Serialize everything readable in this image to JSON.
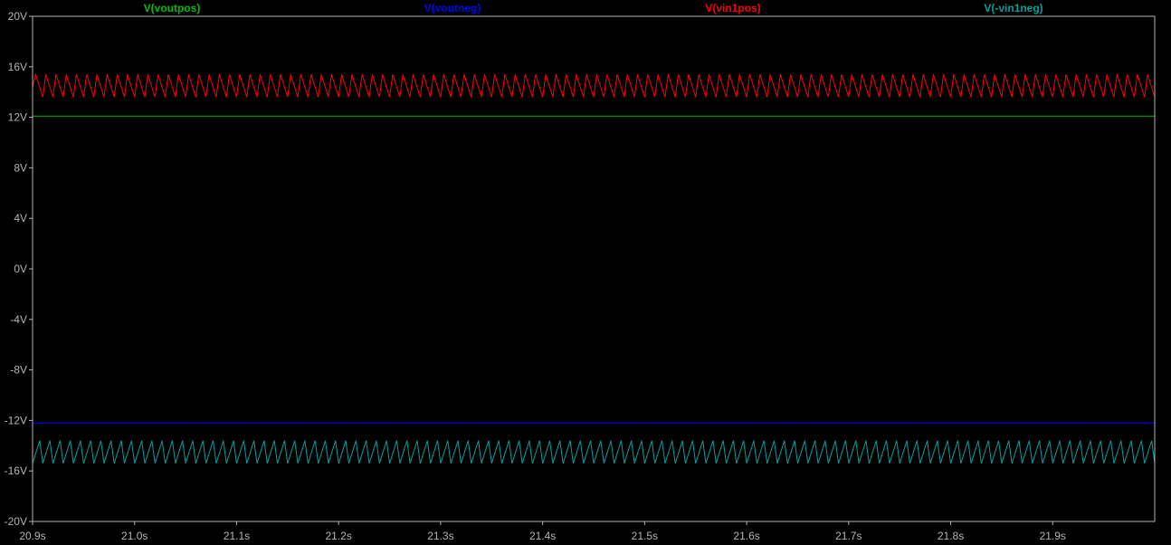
{
  "chart_data": {
    "type": "line",
    "title": "",
    "xlabel": "",
    "ylabel": "",
    "xlim": [
      20.9,
      22.0
    ],
    "ylim": [
      -20,
      20
    ],
    "grid": false,
    "legend_placement": "top",
    "x_ticks": [
      {
        "value": 20.9,
        "label": "20.9s"
      },
      {
        "value": 21.0,
        "label": "21.0s"
      },
      {
        "value": 21.1,
        "label": "21.1s"
      },
      {
        "value": 21.2,
        "label": "21.2s"
      },
      {
        "value": 21.3,
        "label": "21.3s"
      },
      {
        "value": 21.4,
        "label": "21.4s"
      },
      {
        "value": 21.5,
        "label": "21.5s"
      },
      {
        "value": 21.6,
        "label": "21.6s"
      },
      {
        "value": 21.7,
        "label": "21.7s"
      },
      {
        "value": 21.8,
        "label": "21.8s"
      },
      {
        "value": 21.9,
        "label": "21.9s"
      }
    ],
    "y_ticks": [
      {
        "value": 20,
        "label": "20V"
      },
      {
        "value": 16,
        "label": "16V"
      },
      {
        "value": 12,
        "label": "12V"
      },
      {
        "value": 8,
        "label": "8V"
      },
      {
        "value": 4,
        "label": "4V"
      },
      {
        "value": 0,
        "label": "0V"
      },
      {
        "value": -4,
        "label": "-4V"
      },
      {
        "value": -8,
        "label": "-8V"
      },
      {
        "value": -12,
        "label": "-12V"
      },
      {
        "value": -16,
        "label": "-16V"
      },
      {
        "value": -20,
        "label": "-20V"
      }
    ],
    "series": [
      {
        "name": "V(voutpos)",
        "color": "#00c000",
        "shape": "constant",
        "level": 12.1
      },
      {
        "name": "V(voutneg)",
        "color": "#0000ff",
        "shape": "constant",
        "level": -12.2
      },
      {
        "name": "V(vin1pos)",
        "color": "#ff0000",
        "shape": "sawtooth",
        "period": 0.01,
        "phase_start": 20.9,
        "peak": 15.4,
        "trough": 13.6,
        "rise_fraction": 0.3,
        "start_level": 14.4
      },
      {
        "name": "V(-vin1neg)",
        "color": "#00a0a0",
        "shape": "sawtooth-inverted",
        "period": 0.01,
        "phase_start": 20.9,
        "peak": -13.6,
        "trough": -15.4,
        "rise_fraction": 0.3,
        "start_level": -15.4
      }
    ],
    "plot_background": "#000000",
    "axis_color": "#b4b4b4",
    "label_color": "#b4b4b4"
  }
}
